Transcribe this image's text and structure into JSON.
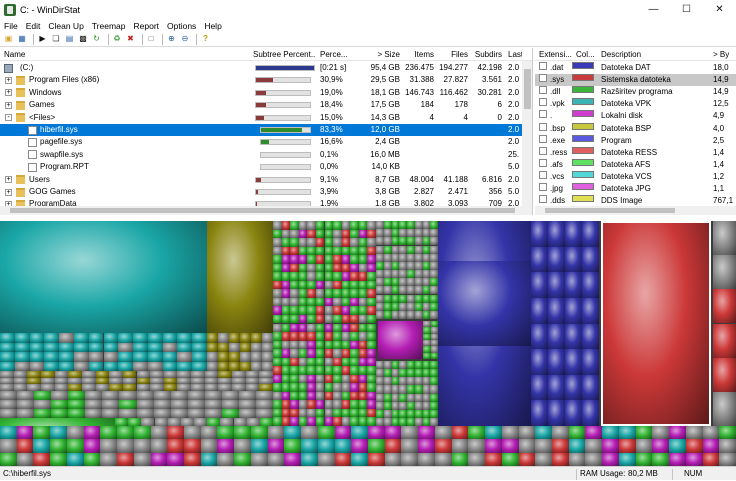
{
  "window": {
    "title": "C: - WinDirStat",
    "minimize": "—",
    "maximize": "☐",
    "close": "✕"
  },
  "menu": [
    "File",
    "Edit",
    "Clean Up",
    "Treemap",
    "Report",
    "Options",
    "Help"
  ],
  "toolbar_icons": [
    "open-icon",
    "save-icon",
    "refresh-icon",
    "copy-path-icon",
    "explorer-icon",
    "command-prompt-icon",
    "refresh-all-icon",
    "recycle-icon",
    "delete-icon",
    "new-folder-icon",
    "zoom-in-icon",
    "zoom-out-icon",
    "help-icon"
  ],
  "tree": {
    "columns": [
      "Name",
      "Subtree Percent...",
      "Perce...",
      "> Size",
      "Items",
      "Files",
      "Subdirs",
      "Last"
    ],
    "rows": [
      {
        "name": "(C:)",
        "depth": 0,
        "icon": "drive",
        "expander": "-",
        "percent": "[0:21 s]",
        "size": "95,4 GB",
        "items": "236.475",
        "files": "194.277",
        "subdirs": "42.198",
        "last": "2.0",
        "bar": 1.0,
        "bar_color": "#2b3a8c",
        "bar_width": 60
      },
      {
        "name": "Program Files (x86)",
        "depth": 1,
        "icon": "folder",
        "expander": "+",
        "percent": "30,9%",
        "size": "29,5 GB",
        "items": "31.388",
        "files": "27.827",
        "subdirs": "3.561",
        "last": "2.0",
        "bar": 0.309,
        "bar_color": "#8b3a3a",
        "bar_width": 56
      },
      {
        "name": "Windows",
        "depth": 1,
        "icon": "folder",
        "expander": "+",
        "percent": "19,0%",
        "size": "18,1 GB",
        "items": "146.743",
        "files": "116.462",
        "subdirs": "30.281",
        "last": "2.0",
        "bar": 0.19,
        "bar_color": "#8b3a3a",
        "bar_width": 56
      },
      {
        "name": "Games",
        "depth": 1,
        "icon": "folder",
        "expander": "+",
        "percent": "18,4%",
        "size": "17,5 GB",
        "items": "184",
        "files": "178",
        "subdirs": "6",
        "last": "2.0",
        "bar": 0.184,
        "bar_color": "#8b3a3a",
        "bar_width": 56
      },
      {
        "name": "<Files>",
        "depth": 1,
        "icon": "folder",
        "expander": "-",
        "percent": "15,0%",
        "size": "14,3 GB",
        "items": "4",
        "files": "4",
        "subdirs": "0",
        "last": "2.0",
        "bar": 0.15,
        "bar_color": "#8b3a3a",
        "bar_width": 56
      },
      {
        "name": "hiberfil.sys",
        "depth": 2,
        "icon": "file",
        "expander": "",
        "percent": "83,3%",
        "size": "12,0 GB",
        "items": "",
        "files": "",
        "subdirs": "",
        "last": "2.0",
        "bar": 0.833,
        "bar_color": "#2e8b2e",
        "bar_width": 51,
        "selected": true
      },
      {
        "name": "pagefile.sys",
        "depth": 2,
        "icon": "file",
        "expander": "",
        "percent": "16,6%",
        "size": "2,4 GB",
        "items": "",
        "files": "",
        "subdirs": "",
        "last": "2.0",
        "bar": 0.166,
        "bar_color": "#2e8b2e",
        "bar_width": 51
      },
      {
        "name": "swapfile.sys",
        "depth": 2,
        "icon": "file",
        "expander": "",
        "percent": "0,1%",
        "size": "16,0 MB",
        "items": "",
        "files": "",
        "subdirs": "",
        "last": "25.",
        "bar": 0.001,
        "bar_color": "#2e8b2e",
        "bar_width": 51
      },
      {
        "name": "Program.RPT",
        "depth": 2,
        "icon": "file",
        "expander": "",
        "percent": "0,0%",
        "size": "14,0 KB",
        "items": "",
        "files": "",
        "subdirs": "",
        "last": "5.0",
        "bar": 0.0,
        "bar_color": "#2e8b2e",
        "bar_width": 51
      },
      {
        "name": "Users",
        "depth": 1,
        "icon": "folder",
        "expander": "+",
        "percent": "9,1%",
        "size": "8,7 GB",
        "items": "48.004",
        "files": "41.188",
        "subdirs": "6.816",
        "last": "2.0",
        "bar": 0.091,
        "bar_color": "#8b3a3a",
        "bar_width": 56
      },
      {
        "name": "GOG Games",
        "depth": 1,
        "icon": "folder",
        "expander": "+",
        "percent": "3,9%",
        "size": "3,8 GB",
        "items": "2.827",
        "files": "2.471",
        "subdirs": "356",
        "last": "5.0",
        "bar": 0.039,
        "bar_color": "#8b3a3a",
        "bar_width": 56
      },
      {
        "name": "ProgramData",
        "depth": 1,
        "icon": "folder",
        "expander": "+",
        "percent": "1,9%",
        "size": "1,8 GB",
        "items": "3.802",
        "files": "3.093",
        "subdirs": "709",
        "last": "2.0",
        "bar": 0.019,
        "bar_color": "#8b3a3a",
        "bar_width": 56
      }
    ]
  },
  "extensions": {
    "columns": [
      "Extensi...",
      "Col...",
      "Description",
      "> By"
    ],
    "rows": [
      {
        "ext": ".dat",
        "color": "#3a3ab8",
        "desc": "Datoteka DAT",
        "bytes": "18,0"
      },
      {
        "ext": ".sys",
        "color": "#c83c3c",
        "desc": "Sistemska datoteka",
        "bytes": "14,9",
        "selected": true
      },
      {
        "ext": ".dll",
        "color": "#3cb43c",
        "desc": "Razširitev programa",
        "bytes": "14,9"
      },
      {
        "ext": ".vpk",
        "color": "#3cb4b4",
        "desc": "Datoteka VPK",
        "bytes": "12,5"
      },
      {
        "ext": ".",
        "color": "#d03cd0",
        "desc": "Lokalni disk",
        "bytes": "4,9"
      },
      {
        "ext": ".bsp",
        "color": "#c8c83c",
        "desc": "Datoteka BSP",
        "bytes": "4,0"
      },
      {
        "ext": ".exe",
        "color": "#5a5ae0",
        "desc": "Program",
        "bytes": "2,5"
      },
      {
        "ext": ".ress",
        "color": "#e06060",
        "desc": "Datoteka RESS",
        "bytes": "1,4"
      },
      {
        "ext": ".afs",
        "color": "#60e060",
        "desc": "Datoteka AFS",
        "bytes": "1,4"
      },
      {
        "ext": ".vcs",
        "color": "#50d8d8",
        "desc": "Datoteka VCS",
        "bytes": "1,2"
      },
      {
        "ext": ".jpg",
        "color": "#e060e0",
        "desc": "Datoteka JPG",
        "bytes": "1,1"
      },
      {
        "ext": ".dds",
        "color": "#e0e050",
        "desc": "DDS Image",
        "bytes": "767,1"
      }
    ]
  },
  "treemap_colors": {
    "cyan": "#1aa6a6",
    "olive": "#8a8410",
    "green": "#32b432",
    "gray": "#8a8a8a",
    "blue": "#3434a8",
    "red": "#cc3838",
    "magenta": "#b41eb4",
    "selection": "#ffffff"
  },
  "status": {
    "path": "C:\\hiberfil.sys",
    "ram_label": "RAM Usage:",
    "ram_value": "80,2 MB",
    "num": "NUM"
  }
}
